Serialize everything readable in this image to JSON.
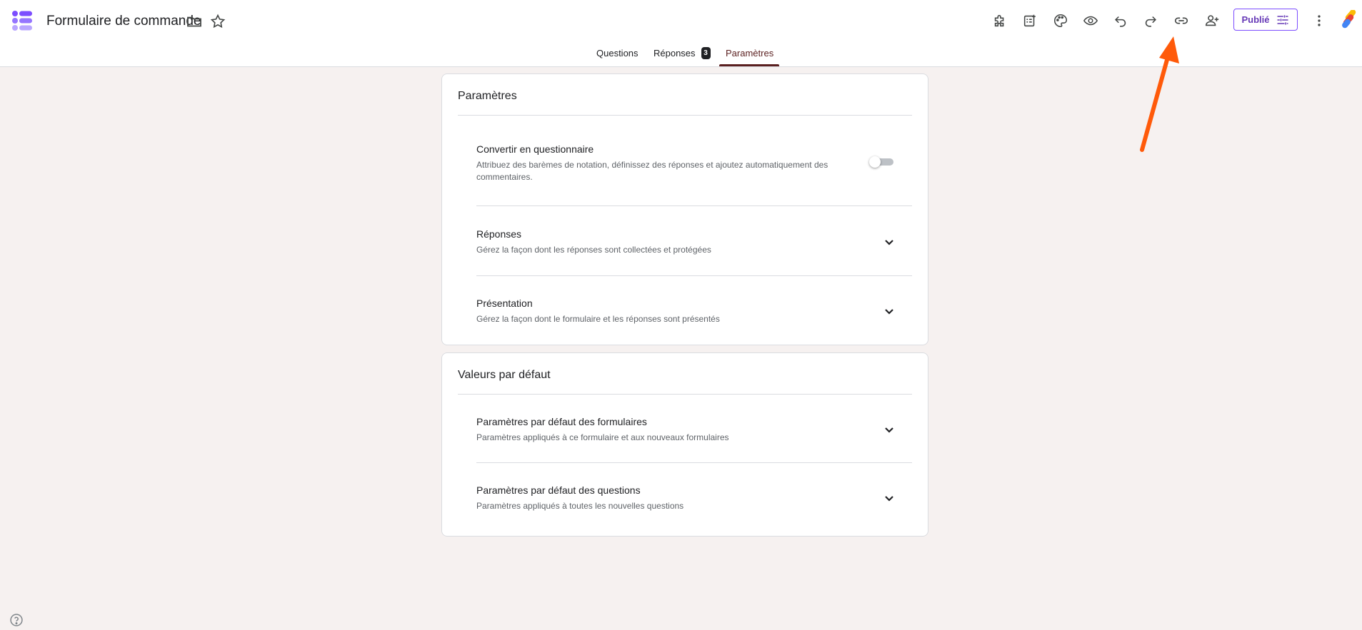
{
  "header": {
    "logo_icon": "google-forms-logo",
    "title": "Formulaire de commande",
    "folder_icon": "folder-icon",
    "star_icon": "star-icon",
    "toolbar_icons": [
      "addon-icon",
      "form-template-icon",
      "palette-icon",
      "preview-eye-icon",
      "undo-icon",
      "redo-icon",
      "link-icon",
      "add-collaborator-icon"
    ],
    "publish_label": "Publié",
    "more_icon": "more-vert-icon"
  },
  "tabs": [
    {
      "label": "Questions"
    },
    {
      "label": "Réponses",
      "badge": "3"
    },
    {
      "label": "Paramètres",
      "active": true
    }
  ],
  "settings_card": {
    "title": "Paramètres",
    "quiz": {
      "title": "Convertir en questionnaire",
      "description": "Attribuez des barèmes de notation, définissez des réponses et ajoutez automatiquement des commentaires.",
      "enabled": false
    },
    "responses": {
      "title": "Réponses",
      "description": "Gérez la façon dont les réponses sont collectées et protégées"
    },
    "presentation": {
      "title": "Présentation",
      "description": "Gérez la façon dont le formulaire et les réponses sont présentés"
    }
  },
  "defaults_card": {
    "title": "Valeurs par défaut",
    "form_defaults": {
      "title": "Paramètres par défaut des formulaires",
      "description": "Paramètres appliqués à ce formulaire et aux nouveaux formulaires"
    },
    "question_defaults": {
      "title": "Paramètres par défaut des questions",
      "description": "Paramètres appliqués à toutes les nouvelles questions"
    }
  },
  "colors": {
    "background": "#f6f1f0",
    "accent": "#5a1f1f",
    "publish": "#673ab7",
    "annotation_arrow": "#ff5a0a"
  }
}
